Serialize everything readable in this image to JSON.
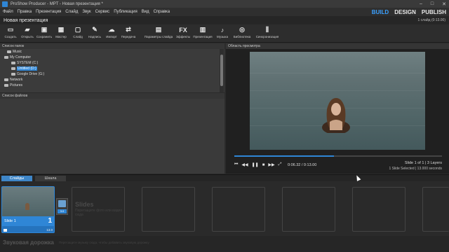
{
  "window": {
    "title": "ProShow Producer - MPT - Новая презентация *",
    "controls": [
      "–",
      "□",
      "✕"
    ]
  },
  "menu": [
    "Файл",
    "Правка",
    "Презентация",
    "Слайд",
    "Звук",
    "Сервис",
    "Публикация",
    "Вид",
    "Справка"
  ],
  "modes": {
    "build": "BUILD",
    "design": "DESIGN",
    "publish": "PUBLISH"
  },
  "project": {
    "name": "Новая презентация",
    "info": "1 слайд (0:13.00)"
  },
  "toolbar": [
    {
      "icon": "new-icon",
      "glyph": "▭",
      "label": "Создать"
    },
    {
      "icon": "open-icon",
      "glyph": "▰",
      "label": "Открыть"
    },
    {
      "icon": "save-icon",
      "glyph": "▣",
      "label": "Сохранить"
    },
    {
      "icon": "wizard-icon",
      "glyph": "▦",
      "label": "Мастер"
    },
    {
      "icon": "slide-icon",
      "glyph": "▢",
      "label": "Слайд"
    },
    {
      "icon": "caption-icon",
      "glyph": "✎",
      "label": "Надпись"
    },
    {
      "icon": "import-icon",
      "glyph": "☁",
      "label": "Импорт"
    },
    {
      "icon": "transfer-icon",
      "glyph": "⇄",
      "label": "Передача"
    },
    {
      "icon": "slide-options-icon",
      "glyph": "▤",
      "label": "Параметры слайда"
    },
    {
      "icon": "effects-icon",
      "glyph": "FX",
      "label": "Эффекты"
    },
    {
      "icon": "presentation-icon",
      "glyph": "▥",
      "label": "Презентация"
    },
    {
      "icon": "music-icon",
      "glyph": "♪",
      "label": "Музыка"
    },
    {
      "icon": "library-icon",
      "glyph": "◎",
      "label": "Библиотека"
    },
    {
      "icon": "sync-icon",
      "glyph": "⫼",
      "label": "Синхронизация"
    }
  ],
  "folders": {
    "header": "Список папок",
    "items": [
      {
        "label": "Music",
        "selected": false
      },
      {
        "label": "My Computer",
        "selected": false
      },
      {
        "label": "SYSTEM (C:)",
        "selected": false
      },
      {
        "label": "Untitled (D:)",
        "selected": true
      },
      {
        "label": "Google Drive (G:)",
        "selected": false
      },
      {
        "label": "Network",
        "selected": false
      },
      {
        "label": "Pictures",
        "selected": false
      }
    ]
  },
  "files": {
    "header": "Список файлов"
  },
  "preview": {
    "header": "Область просмотра",
    "progress": 0.48,
    "timecode": "0:06.32 / 0:13.00",
    "slide_info": "Slide 1 of 1  |  3 Layers",
    "selection_info": "1 Slide Selected  |  13.000 seconds"
  },
  "tabs": {
    "slides": "Слайды",
    "timeline": "Шкала"
  },
  "slides": [
    {
      "label": "Slide 1",
      "number": "1",
      "duration": "13.0"
    }
  ],
  "transition": {
    "duration": "3.0"
  },
  "slides_hint": {
    "title": "Slides",
    "body": "Перетащите фото или видео сюда"
  },
  "soundtrack": {
    "label": "Звуковая дорожка",
    "hint": "Перетащите музыку сюда, чтобы добавить звуковую дорожку"
  },
  "colors": {
    "accent": "#2f86d6",
    "background": "#2b2b2b"
  }
}
